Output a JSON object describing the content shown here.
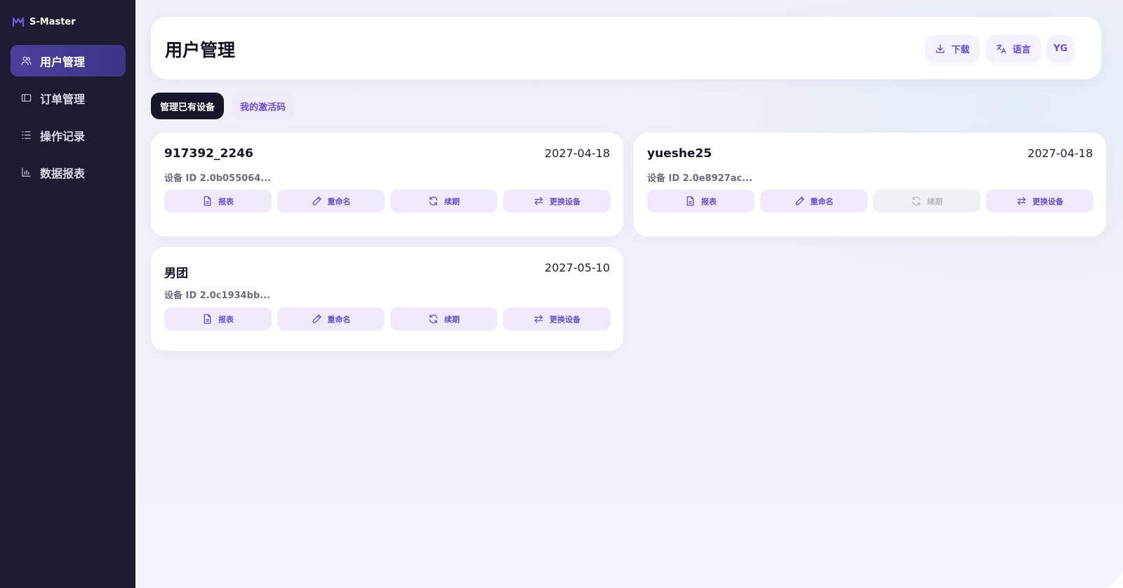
{
  "app": {
    "name": "S-Master"
  },
  "colors": {
    "accent": "#6a4fd0",
    "sidebar": "#1c1b31",
    "active_nav": "#4a3f9a"
  },
  "sidebar": {
    "items": [
      {
        "label": "用户管理",
        "icon": "users-icon",
        "active": true
      },
      {
        "label": "订单管理",
        "icon": "order-icon",
        "active": false
      },
      {
        "label": "操作记录",
        "icon": "list-icon",
        "active": false
      },
      {
        "label": "数据报表",
        "icon": "bar-chart-icon",
        "active": false
      }
    ]
  },
  "header": {
    "title": "用户管理",
    "download_label": "下载",
    "language_label": "语言",
    "avatar_initials": "YG"
  },
  "tabs": [
    {
      "label": "管理已有设备",
      "active": true
    },
    {
      "label": "我的激活码",
      "active": false
    }
  ],
  "devices": [
    {
      "name": "917392_2246",
      "expiry": "2027-04-18",
      "device_id": "设备 ID 2.0b055064...",
      "actions": {
        "report": "报表",
        "rename": "重命名",
        "renew": "续期",
        "replace": "更换设备"
      },
      "renew_disabled": false
    },
    {
      "name": "yueshe25",
      "expiry": "2027-04-18",
      "device_id": "设备 ID 2.0e8927ac...",
      "actions": {
        "report": "报表",
        "rename": "重命名",
        "renew": "续期",
        "replace": "更换设备"
      },
      "renew_disabled": true
    },
    {
      "name": "男团",
      "expiry": "2027-05-10",
      "device_id": "设备 ID 2.0c1934bb...",
      "actions": {
        "report": "报表",
        "rename": "重命名",
        "renew": "续期",
        "replace": "更换设备"
      },
      "renew_disabled": false
    }
  ]
}
